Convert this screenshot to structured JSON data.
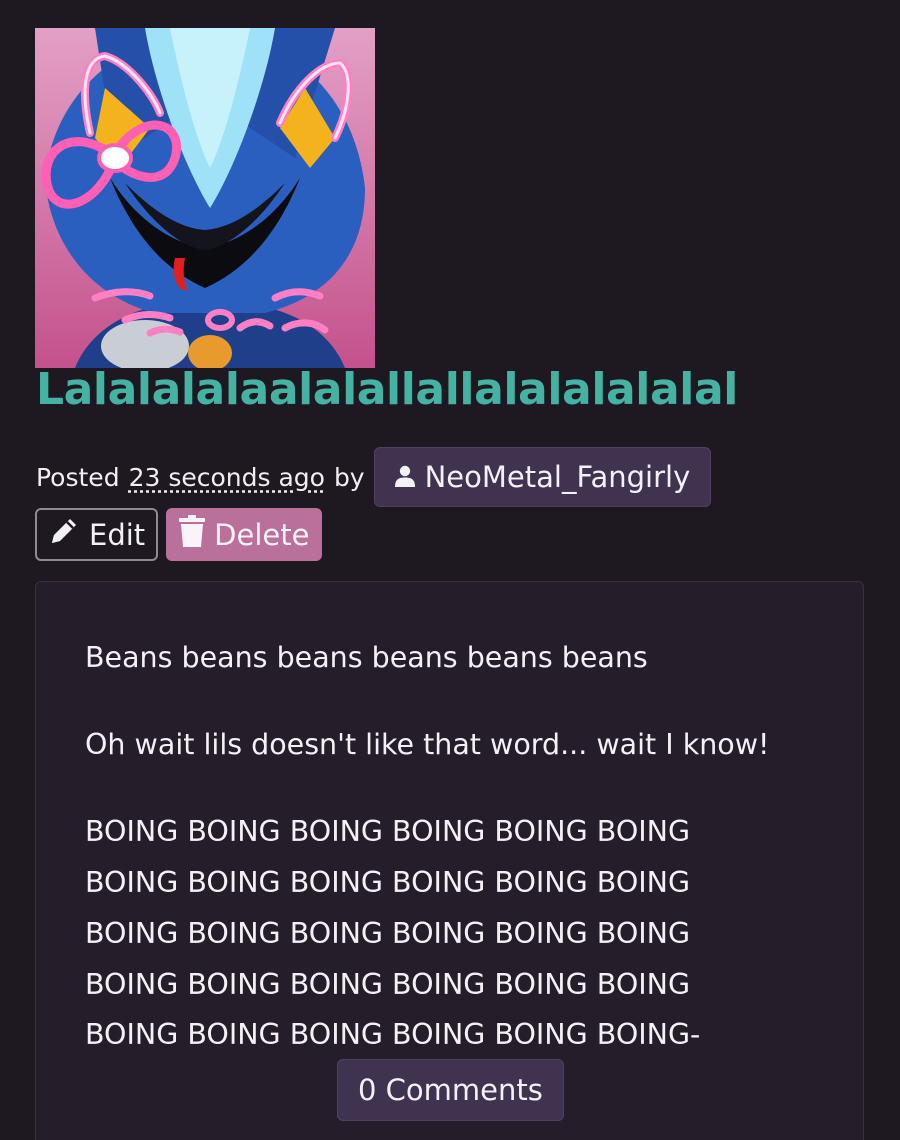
{
  "post": {
    "title": "Lalalalalaalalallallalalalalalal",
    "posted_prefix": "Posted",
    "posted_time": "23 seconds ago",
    "posted_by": "by",
    "author": "NeoMetal_Fangirly",
    "author_icon": "user-icon"
  },
  "actions": {
    "edit_label": "Edit",
    "edit_icon": "pencil-icon",
    "delete_label": "Delete",
    "delete_icon": "trash-icon"
  },
  "content": {
    "paragraph_1": "Beans beans beans beans beans beans",
    "paragraph_2": "Oh wait lils doesn't like that word... wait I know!",
    "boing_lines": [
      "BOING BOING BOING BOING BOING BOING",
      "BOING BOING BOING BOING BOING BOING",
      "BOING BOING BOING BOING BOING BOING",
      "BOING BOING BOING BOING BOING BOING",
      "BOING BOING BOING BOING BOING BOING-"
    ]
  },
  "comments": {
    "label": "0 Comments"
  },
  "colors": {
    "background": "#1e1820",
    "title": "#45b3a3",
    "author_button": "#3f3350",
    "delete_button": "#b9709b",
    "card": "#251d29"
  }
}
